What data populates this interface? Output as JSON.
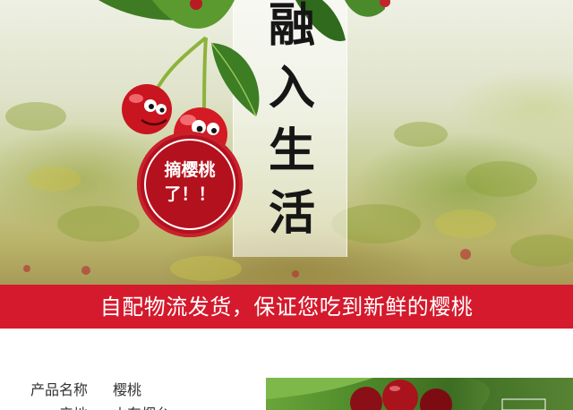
{
  "hero": {
    "slogan": [
      "融",
      "入",
      "生",
      "活"
    ],
    "badge": {
      "line1": "摘樱桃",
      "line2": "了！！"
    }
  },
  "ribbon": {
    "text": "自配物流发货，保证您吃到新鲜的樱桃"
  },
  "product_info": {
    "rows": [
      {
        "label": "产品名称",
        "value": "樱桃"
      },
      {
        "label": "产地",
        "value": "山东烟台"
      }
    ]
  },
  "colors": {
    "brand_red": "#d41a2c",
    "seal_red": "#b3111d"
  }
}
